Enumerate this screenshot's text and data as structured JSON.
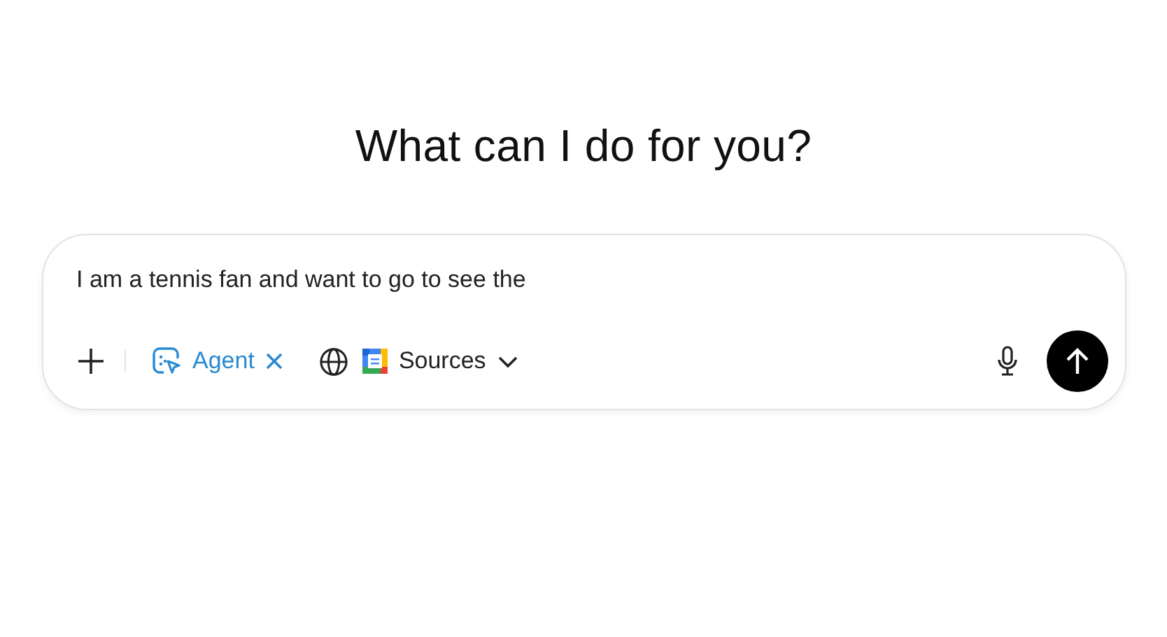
{
  "heading": "What can I do for you?",
  "prompt": {
    "value": "I am a tennis fan and want to go to see the "
  },
  "toolbar": {
    "agent_chip": {
      "label": "Agent"
    },
    "sources_button": {
      "label": "Sources"
    }
  }
}
